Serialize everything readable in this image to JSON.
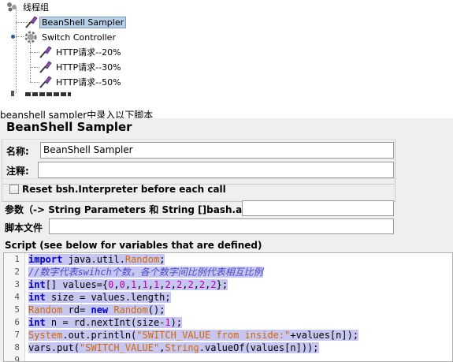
{
  "tree": {
    "root": "线程组",
    "items": [
      {
        "label": "BeanShell Sampler",
        "selected": true,
        "icon": "pipette-icon"
      },
      {
        "label": "Switch Controller",
        "selected": false,
        "icon": "gear-icon"
      },
      {
        "label": "HTTP请求--20%",
        "selected": false,
        "icon": "pipette-icon"
      },
      {
        "label": "HTTP请求--30%",
        "selected": false,
        "icon": "pipette-icon"
      },
      {
        "label": "HTTP请求--50%",
        "selected": false,
        "icon": "pipette-icon"
      }
    ]
  },
  "caption": "beanshell sampler中录入以下脚本",
  "panel": {
    "title": "BeanShell Sampler",
    "name_label": "名称:",
    "name_value": "BeanShell Sampler",
    "comment_label": "注释:",
    "comment_value": "",
    "reset_label": "Reset bsh.Interpreter before each call",
    "reset_checked": false,
    "params_label": "参数（-> String Parameters 和 String []bash.args)",
    "params_value": "",
    "script_file_label": "脚本文件",
    "script_file_value": "",
    "script_label": "Script (see below for variables that are defined)"
  },
  "script": {
    "line_numbers": [
      "1",
      "2",
      "3",
      "4",
      "5",
      "6",
      "7",
      "8",
      "9"
    ],
    "lines": [
      "import java.util.Random;",
      "//数字代表swihch个数，各个数字间比例代表相互比例",
      "int[] values={0,0,1,1,1,2,2,2,2,2};",
      "int size = values.length;",
      "Random rd= new Random();",
      "int n = rd.nextInt(size-1);",
      "System.out.println(\"SWITCH_VALUE from inside:\"+values[n]);",
      "vars.put(\"SWITCH_VALUE\",String.valueOf(values[n]));",
      ""
    ]
  },
  "colors": {
    "selection": "#b8cfe5",
    "code_highlight": "#c6c6f0",
    "keyword": "#0000c8",
    "string": "#d26a00",
    "comment": "#4a4acc"
  }
}
